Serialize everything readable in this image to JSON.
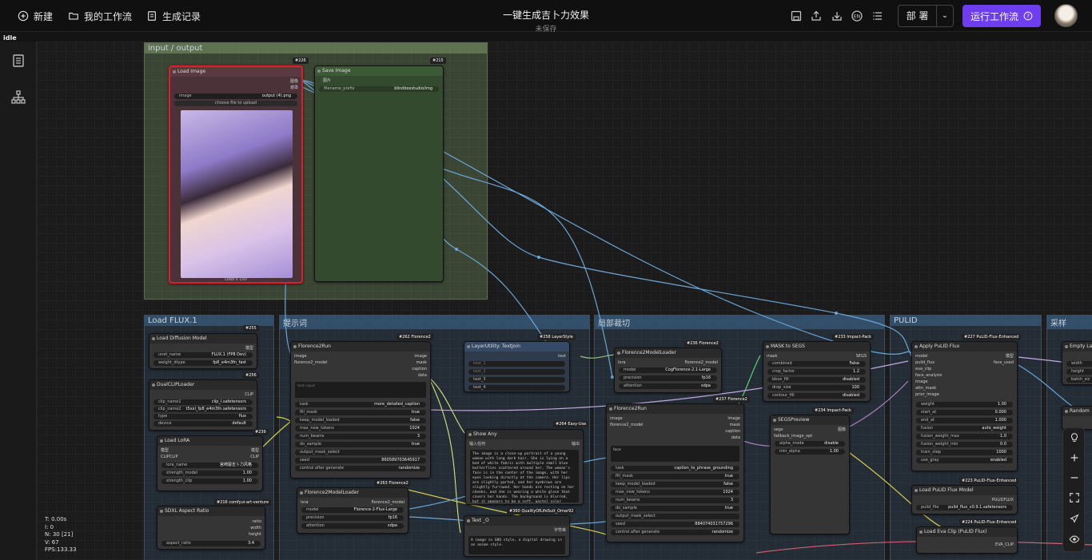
{
  "topbar": {
    "new_label": "新建",
    "workflows_label": "我的工作流",
    "history_label": "生成记录",
    "title": "一键生成吉卜力效果",
    "subtitle": "未保存",
    "deploy_label": "部 署",
    "run_label": "运行工作流"
  },
  "status": "idle",
  "stats": {
    "t": "T: 0.00s",
    "i": "I: 0",
    "n": "N: 30 [21]",
    "v": "V: 67",
    "fps": "FPS:133.33"
  },
  "groups": {
    "io": "input / output",
    "flux": "Load FLUX.1",
    "prompt": "提示词",
    "crop": "局部裁切",
    "pulid": "PULID",
    "sampler": "采样"
  },
  "nodes": {
    "load_image": {
      "title": "Load Image",
      "badge": "#226",
      "out_image": "图像",
      "out_mask": "遮罩",
      "image_label": "image",
      "image_value": "output (4).png",
      "upload": "choose file to upload",
      "footer": "Load x 100"
    },
    "save_image": {
      "title": "Save Image",
      "badge": "#215",
      "in_image": "图片",
      "prefix_label": "filename_prefix",
      "prefix_value": "blindboxstudio/img"
    },
    "diffusion": {
      "title": "Load Diffusion Model",
      "badge": "#255",
      "out": "模型",
      "unet_label": "unet_name",
      "unet_value": "FLUX.1 (FP8 Dev)",
      "dtype_label": "weight_dtype",
      "dtype_value": "fp8_e4m3fn_fast"
    },
    "clip": {
      "title": "DualCLIPLoader",
      "badge": "#256",
      "out": "CLIP",
      "c1_label": "clip_name1",
      "c1_value": "clip_l.safetensors",
      "c2_label": "clip_name2",
      "c2_value": "t5xxl_fp8_e4m3fn.safetensors",
      "type_label": "type",
      "type_value": "flux",
      "device_label": "device",
      "device_value": "default"
    },
    "lora": {
      "title": "Load LoRA",
      "badge": "#239",
      "in_model": "模型",
      "in_clip": "CLIPCLIP",
      "out_model": "模型",
      "out_clip": "CLIP",
      "name_label": "lora_name",
      "name_value": "宫崎骏吉卜力风格",
      "sm_label": "strength_model",
      "sm_value": "1.00",
      "sc_label": "strength_clip",
      "sc_value": "1.00"
    },
    "aspect": {
      "title": "SDXL Aspect Ratio",
      "badge": "#216 comfyui-art-venture",
      "o1": "ratio",
      "o2": "width",
      "o3": "height",
      "ar_label": "aspect_ratio",
      "ar_value": "3:4"
    },
    "florence_run1": {
      "title": "Florence2Run",
      "badge": "#262 Florence2",
      "in1": "image",
      "in2": "florence2_model",
      "o1": "image",
      "o2": "mask",
      "o3": "caption",
      "o4": "data",
      "text_ph": "text input",
      "task_label": "task",
      "task_value": "more_detailed_caption",
      "fm_label": "fill_mask",
      "fm_value": "true",
      "km_label": "keep_model_loaded",
      "km_value": "false",
      "mnt_label": "max_new_tokens",
      "mnt_value": "1024",
      "nb_label": "num_beams",
      "nb_value": "3",
      "ds_label": "do_sample",
      "ds_value": "true",
      "om_label": "output_mask_select",
      "seed_label": "seed",
      "seed_value": "860589703645917",
      "cag_label": "control after generate",
      "cag_value": "randomize"
    },
    "florence_loader1": {
      "title": "Florence2ModelLoader",
      "badge": "#263 Florence2",
      "in": "lora",
      "out": "florence2_model",
      "m_label": "model",
      "m_value": "Florence-2-Flux-Large",
      "p_label": "precision",
      "p_value": "fp16",
      "a_label": "attention",
      "a_value": "sdpa"
    },
    "textjoin": {
      "title": "LayerUtility: TextJoin",
      "badge": "#258 LayerStyle",
      "out": "text",
      "t1": "text_1",
      "t2": "text_2",
      "t3": "text_3",
      "t4": "text_4"
    },
    "show_any": {
      "title": "Show Any",
      "badge": "#264 Easy-Use",
      "in": "输入任何",
      "out": "输出",
      "text": "The image is a close-up portrait of a young woman with long dark hair. She is lying on a bed of white fabric with multiple small blue butterflies scattered around her. The woman's face is in the center of the image, with her eyes looking directly at the camera. Her lips are slightly parted, and her eyebrows are slightly furrowed. Her hands are resting on her cheeks, and she is wearing a white glove that covers her hands. The background is blurred, but it appears to be a soft, pastel color palette."
    },
    "text_o": {
      "title": "Text _O",
      "badge": "#360 QualityOfLifeSuit_Omar92",
      "out": "字符串",
      "text": "A image in GBQ style, a digital drawing in an anime style."
    },
    "florence_loader2": {
      "title": "Florence2ModelLoader",
      "badge": "#236 Florence2",
      "in": "lora",
      "out": "florence2_model",
      "m_label": "model",
      "m_value": "CogFlorence-2.1-Large",
      "p_label": "precision",
      "p_value": "fp16",
      "a_label": "attention",
      "a_value": "sdpa"
    },
    "florence_run2": {
      "title": "Florence2Run",
      "badge": "#237 Florence2",
      "in1": "image",
      "in2": "florence2_model",
      "o1": "image",
      "o2": "mask",
      "o3": "caption",
      "o4": "data",
      "text_value": "face",
      "task_label": "task",
      "task_value": "caption_to_phrase_grounding",
      "fm_label": "fill_mask",
      "fm_value": "true",
      "km_label": "keep_model_loaded",
      "km_value": "false",
      "mnt_label": "max_new_tokens",
      "mnt_value": "1024",
      "nb_label": "num_beams",
      "nb_value": "3",
      "ds_label": "do_sample",
      "ds_value": "true",
      "om_label": "output_mask_select",
      "seed_label": "seed",
      "seed_value": "884074031757296",
      "cag_label": "control after generate",
      "cag_value": "randomize"
    },
    "mask_segs": {
      "title": "MASK to SEGS",
      "badge": "#233 Impact-Pack",
      "in": "mask",
      "out": "SEGS",
      "r1_label": "combined",
      "r1_value": "False",
      "r2_label": "crop_factor",
      "r2_value": "1.2",
      "r3_label": "bbox_fill",
      "r3_value": "disabled",
      "r4_label": "drop_size",
      "r4_value": "100",
      "r5_label": "contour_fill",
      "r5_value": "disabled"
    },
    "segs_preview": {
      "title": "SEGSPreview",
      "badge": "#234 Impact-Pack",
      "in1": "segs",
      "in2": "fallback_image_opt",
      "out": "图像",
      "r1_label": "alpha_mode",
      "r1_value": "disable",
      "r2_label": "min_alpha",
      "r2_value": "1.00"
    },
    "pulid": {
      "title": "Apply PuLID Flux",
      "badge": "#227 PuLID-Flux-Enhanced",
      "in1": "model",
      "in2": "pulid_flux",
      "in3": "eva_clip",
      "in4": "face_analysis",
      "in5": "image",
      "in6": "attn_mask",
      "in7": "prior_image",
      "o1": "模型",
      "o2": "face_used",
      "r1_label": "weight",
      "r1_value": "1.00",
      "r2_label": "start_at",
      "r2_value": "0.000",
      "r3_label": "end_at",
      "r3_value": "1.000",
      "r4_label": "fusion",
      "r4_value": "auto_weight",
      "r5_label": "fusion_weight_max",
      "r5_value": "1.0",
      "r6_label": "fusion_weight_min",
      "r6_value": "0.0",
      "r7_label": "train_step",
      "r7_value": "1000",
      "r8_label": "use_gray",
      "r8_value": "enabled"
    },
    "pulid_model": {
      "title": "Load PuLID Flux Model",
      "badge": "#223 PuLID-Flux-Enhanced",
      "out": "PULIDFLUX",
      "f_label": "pulid_file",
      "f_value": "pulid_flux_v0.9.1.safetensors"
    },
    "eva_clip": {
      "title": "Load Eva Clip (PuLID Flux)",
      "badge": "#224 PuLID-Flux-Enhanced",
      "out": "EVA_CLIP"
    },
    "empty_latent": {
      "title": "Empty La",
      "w": "width",
      "h": "height",
      "b": "batch_siz"
    },
    "random": {
      "title": "Random"
    }
  }
}
